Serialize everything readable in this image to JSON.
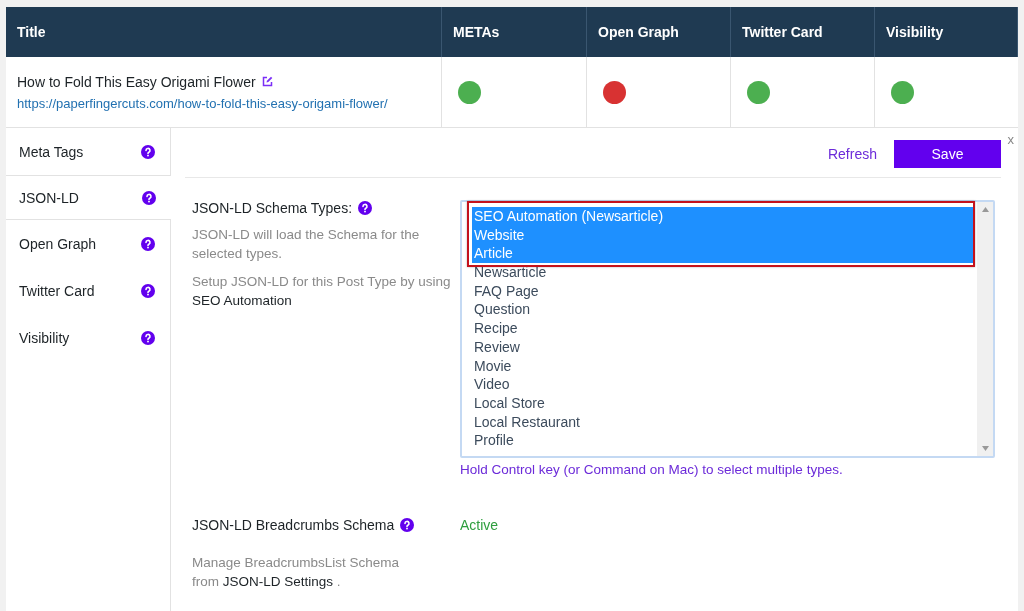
{
  "table": {
    "columns": [
      "Title",
      "METAs",
      "Open Graph",
      "Twitter Card",
      "Visibility"
    ],
    "rows": [
      {
        "title": "How to Fold This Easy Origami Flower",
        "url": "https://paperfingercuts.com/how-to-fold-this-easy-origami-flower/",
        "statuses": [
          {
            "color": "#4caf50"
          },
          {
            "color": "#d83232"
          },
          {
            "color": "#4caf50"
          },
          {
            "color": "#4caf50"
          }
        ]
      }
    ]
  },
  "sidebar": {
    "items": [
      {
        "label": "Meta Tags",
        "selected": false
      },
      {
        "label": "JSON-LD",
        "selected": true
      },
      {
        "label": "Open Graph",
        "selected": false
      },
      {
        "label": "Twitter Card",
        "selected": false
      },
      {
        "label": "Visibility",
        "selected": false
      }
    ]
  },
  "panel": {
    "close": "x",
    "refresh": "Refresh",
    "save": "Save",
    "schema_types": {
      "label": "JSON-LD Schema Types:",
      "description": "JSON-LD will load the Schema for the selected types.",
      "setup_text": "Setup JSON-LD for this Post Type by using",
      "setup_link": "SEO Automation",
      "options": [
        {
          "label": "SEO Automation (Newsarticle)",
          "selected": true
        },
        {
          "label": "Website",
          "selected": true
        },
        {
          "label": "Article",
          "selected": true
        },
        {
          "label": "Newsarticle",
          "selected": false
        },
        {
          "label": "FAQ Page",
          "selected": false
        },
        {
          "label": "Question",
          "selected": false
        },
        {
          "label": "Recipe",
          "selected": false
        },
        {
          "label": "Review",
          "selected": false
        },
        {
          "label": "Movie",
          "selected": false
        },
        {
          "label": "Video",
          "selected": false
        },
        {
          "label": "Local Store",
          "selected": false
        },
        {
          "label": "Local Restaurant",
          "selected": false
        },
        {
          "label": "Profile",
          "selected": false
        }
      ],
      "hint": "Hold Control key (or Command on Mac) to select multiple types."
    },
    "breadcrumbs": {
      "label": "JSON-LD Breadcrumbs Schema",
      "status": "Active",
      "text": "Manage BreadcrumbsList Schema from",
      "link": "JSON-LD Settings",
      "after": " ."
    }
  }
}
